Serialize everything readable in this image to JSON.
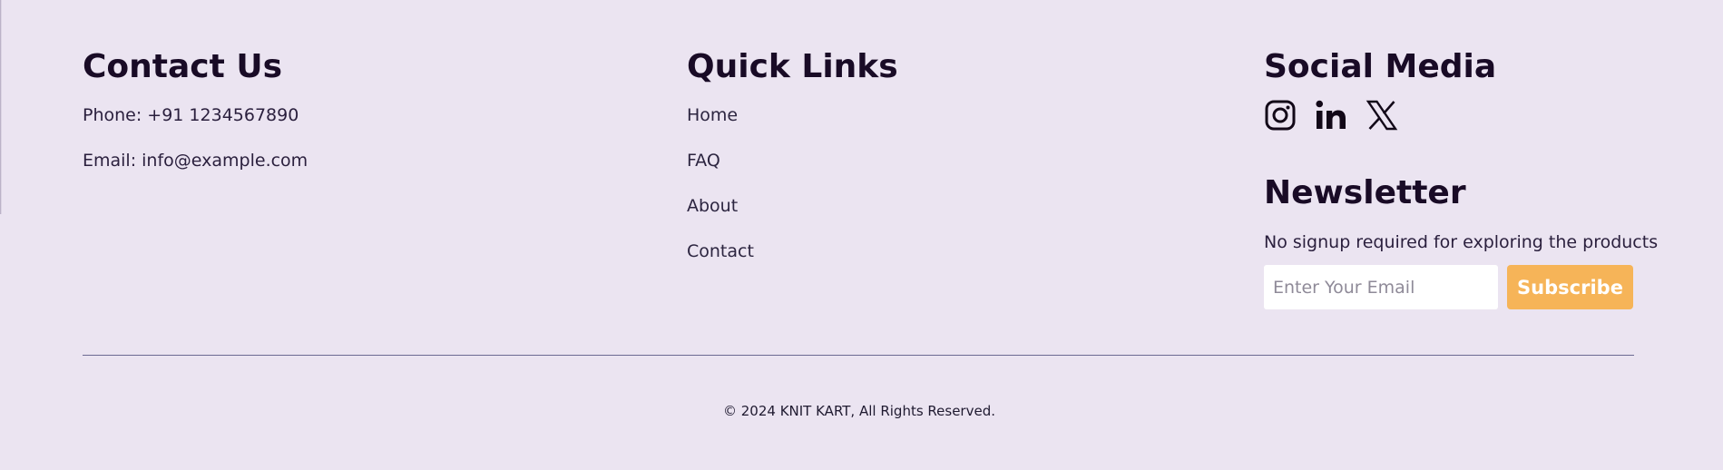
{
  "contact": {
    "heading": "Contact Us",
    "phone": "Phone: +91 1234567890",
    "email": "Email: info@example.com"
  },
  "quick_links": {
    "heading": "Quick Links",
    "items": [
      {
        "label": "Home"
      },
      {
        "label": "FAQ"
      },
      {
        "label": "About"
      },
      {
        "label": "Contact"
      }
    ]
  },
  "social": {
    "heading": "Social Media",
    "icons": [
      "instagram-icon",
      "linkedin-icon",
      "x-icon"
    ]
  },
  "newsletter": {
    "heading": "Newsletter",
    "description": "No signup required for exploring the products",
    "input_placeholder": "Enter Your Email",
    "input_value": "",
    "button_label": "Subscribe"
  },
  "footer": {
    "copyright": "© 2024 KNIT KART, All Rights Reserved."
  },
  "colors": {
    "background": "#ebe4f1",
    "heading": "#190b26",
    "button": "#f6b458",
    "button_text": "#ffffff",
    "divider": "#6c6a92"
  }
}
